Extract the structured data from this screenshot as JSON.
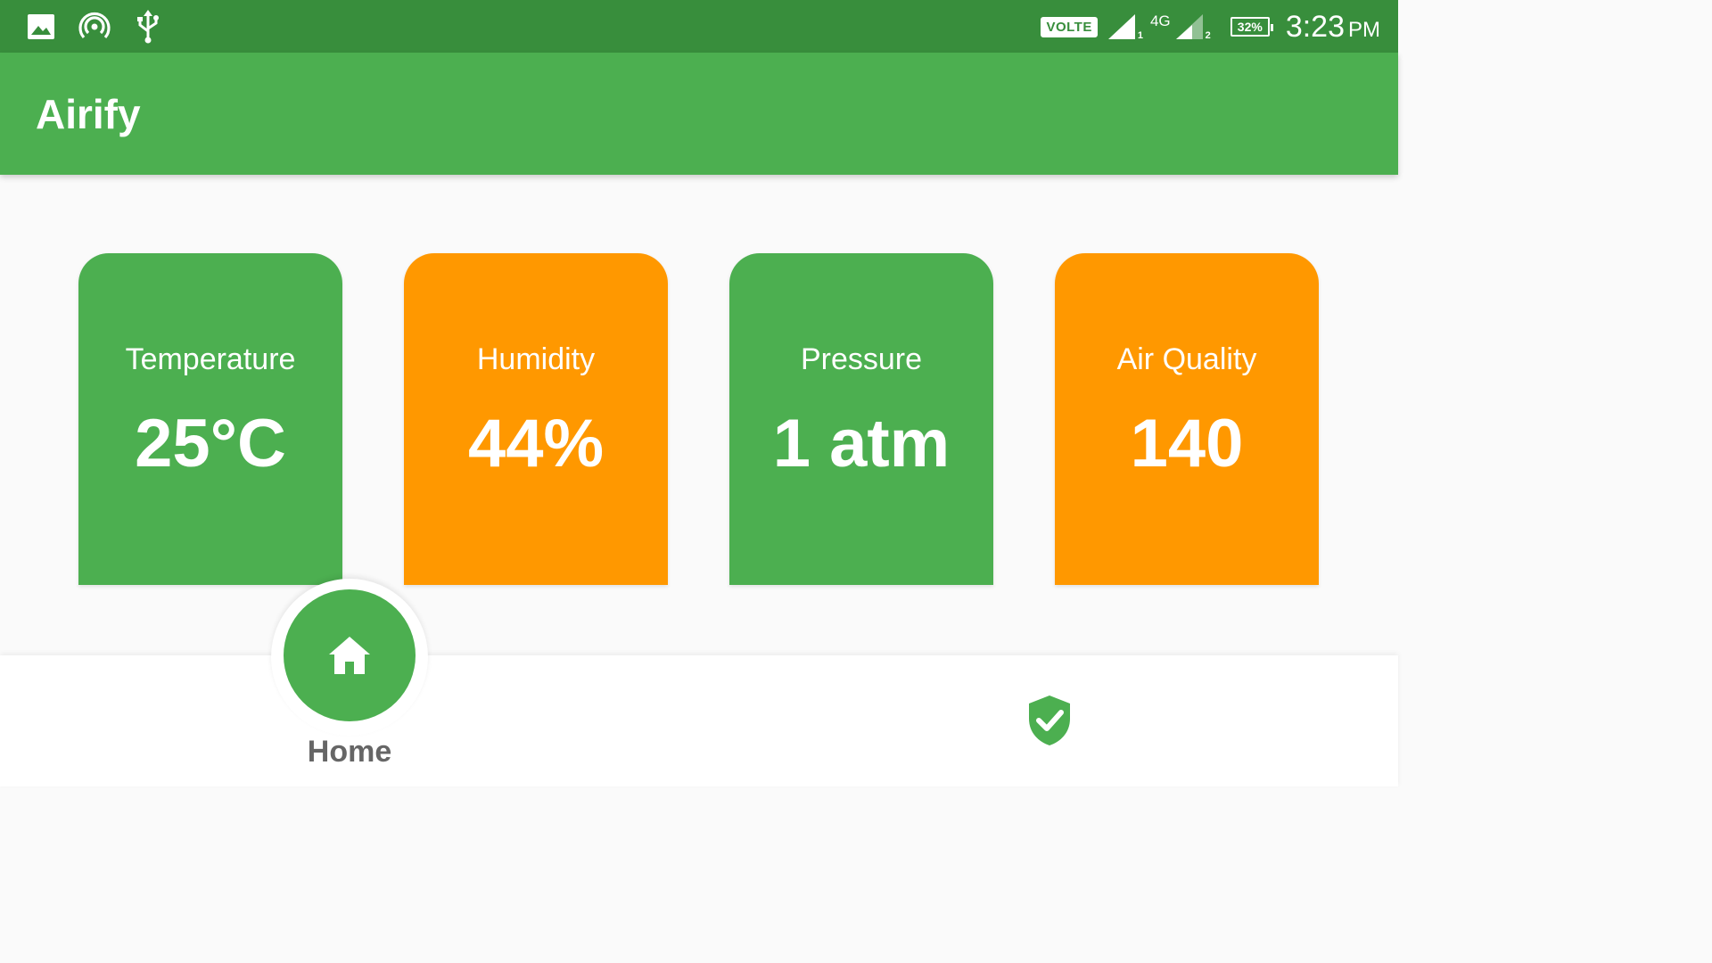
{
  "status_bar": {
    "icons_left": [
      "image-icon",
      "hotspot-icon",
      "usb-icon"
    ],
    "volte": "VOLTE",
    "sim1_sub": "1",
    "network": "4G",
    "sim2_sub": "2",
    "battery": "32%",
    "time": "3:23",
    "ampm": "PM"
  },
  "app_bar": {
    "title": "Airify"
  },
  "cards": [
    {
      "label": "Temperature",
      "value": "25°C",
      "color": "#4caf50"
    },
    {
      "label": "Humidity",
      "value": "44%",
      "color": "#ff9800"
    },
    {
      "label": "Pressure",
      "value": "1 atm",
      "color": "#4caf50"
    },
    {
      "label": "Air Quality",
      "value": "140",
      "color": "#ff9800"
    }
  ],
  "bottom_nav": {
    "home_label": "Home",
    "home_icon": "home-icon",
    "second_icon": "verified-shield-icon"
  },
  "colors": {
    "status_bar": "#388e3c",
    "primary": "#4caf50",
    "accent": "#ff9800"
  }
}
